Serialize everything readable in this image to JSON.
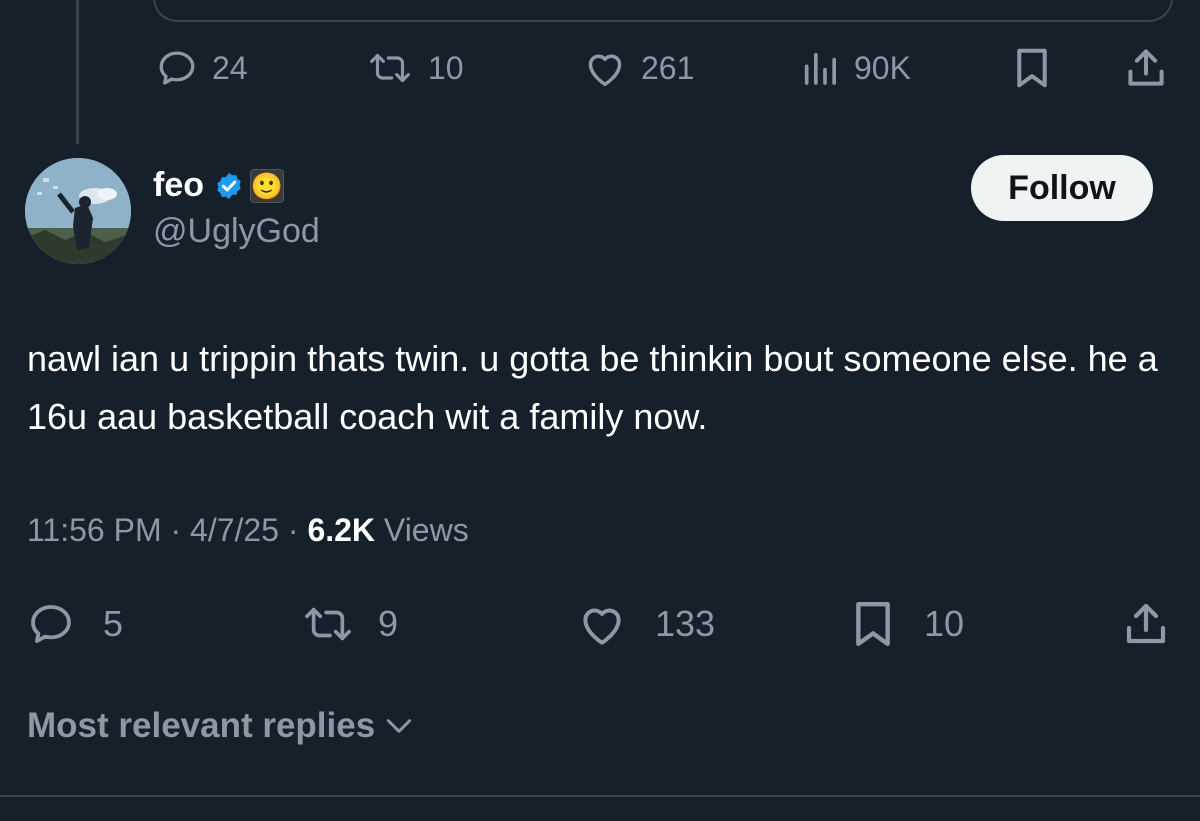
{
  "quoted_tweet_actions": {
    "replies": "24",
    "retweets": "10",
    "likes": "261",
    "views": "90K"
  },
  "tweet": {
    "author_name": "feo",
    "author_handle": "@UglyGod",
    "verified": true,
    "badge_emoji": "🙂",
    "follow_label": "Follow",
    "text": "nawl ian u trippin thats twin. u gotta be thinkin bout someone else. he a 16u aau basketball coach wit a family now.",
    "time": "11:56 PM",
    "date": "4/7/25",
    "views_count": "6.2K",
    "views_label": "Views",
    "separator": " · "
  },
  "tweet_actions": {
    "replies": "5",
    "retweets": "9",
    "likes": "133",
    "bookmarks": "10"
  },
  "replies_sort": {
    "label": "Most relevant replies"
  },
  "colors": {
    "background": "#15202b",
    "muted_text": "#8b98a5",
    "divider": "#38444d",
    "verified_blue": "#1d9bf0",
    "follow_bg": "#eff3f4"
  }
}
